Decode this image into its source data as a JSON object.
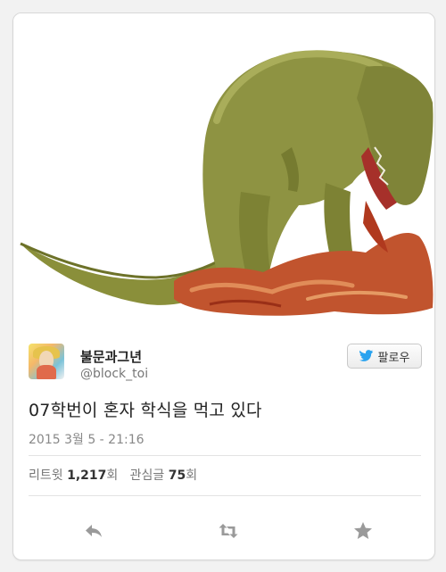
{
  "tweet": {
    "author_name": "불문과그년",
    "author_handle": "@block_toi",
    "follow_label": "팔로우",
    "text": "07학번이 혼자 학식을 먹고 있다",
    "timestamp": "2015 3월 5 - 21:16",
    "stats": {
      "retweet_label": "리트윗",
      "retweet_count": "1,217",
      "retweet_unit": "회",
      "favorite_label": "관심글",
      "favorite_count": "75",
      "favorite_unit": "회"
    }
  },
  "icons": {
    "follow": "twitter-bird-icon",
    "reply": "reply-icon",
    "retweet": "retweet-icon",
    "favorite": "star-icon"
  },
  "colors": {
    "twitter_blue": "#2aa3ef",
    "action_gray": "#9a9a9a"
  }
}
